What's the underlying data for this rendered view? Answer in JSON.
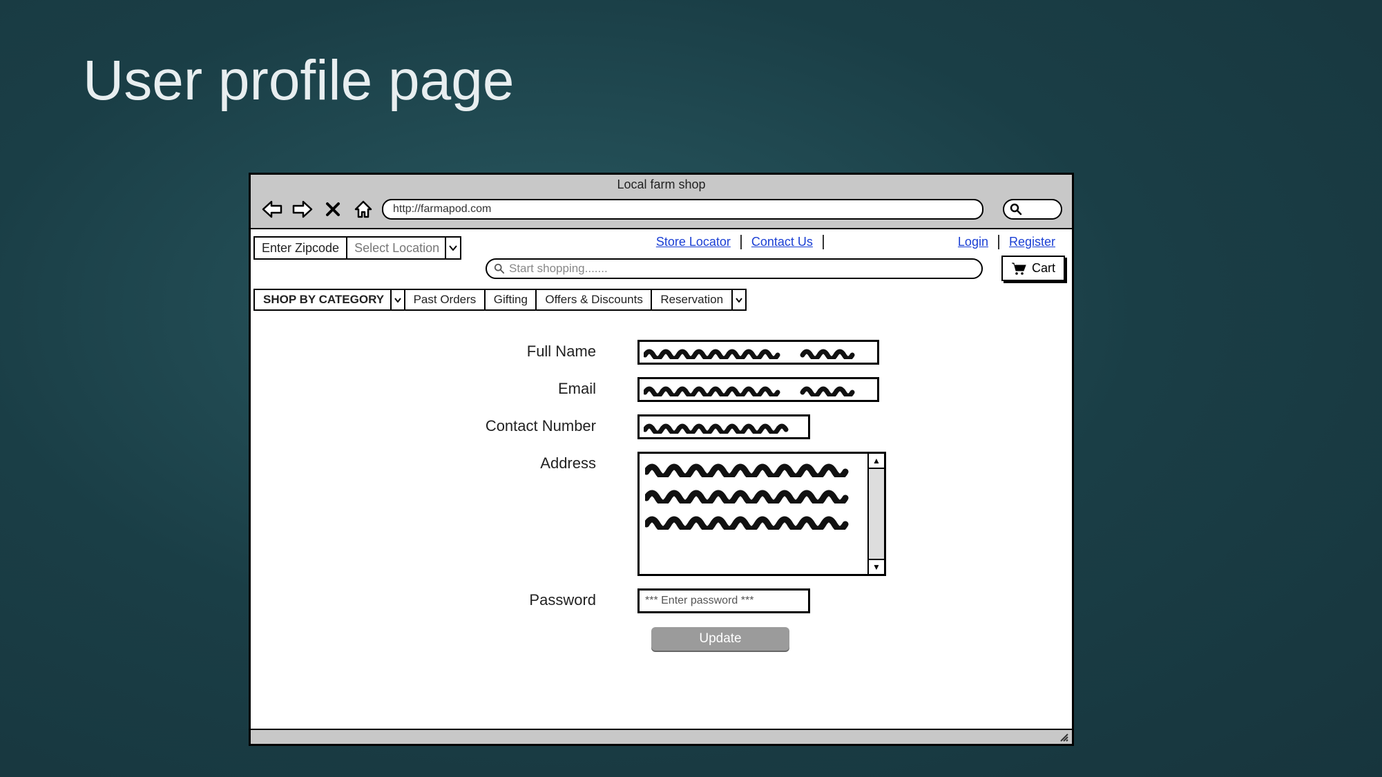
{
  "slide": {
    "title": "User profile page"
  },
  "browser": {
    "window_title": "Local farm shop",
    "url": "http://farmapod.com"
  },
  "top_controls": {
    "zipcode_placeholder": "Enter Zipcode",
    "location_placeholder": "Select Location"
  },
  "top_links": {
    "store_locator": "Store Locator",
    "contact_us": "Contact Us",
    "login": "Login",
    "register": "Register"
  },
  "search": {
    "placeholder": "Start shopping......."
  },
  "cart": {
    "label": "Cart"
  },
  "nav_tabs": {
    "shop_by_category": "SHOP BY CATEGORY",
    "past_orders": "Past Orders",
    "gifting": "Gifting",
    "offers": "Offers & Discounts",
    "reservation": "Reservation"
  },
  "form": {
    "full_name_label": "Full Name",
    "email_label": "Email",
    "contact_label": "Contact Number",
    "address_label": "Address",
    "password_label": "Password",
    "password_placeholder": "*** Enter password ***",
    "update_label": "Update"
  }
}
